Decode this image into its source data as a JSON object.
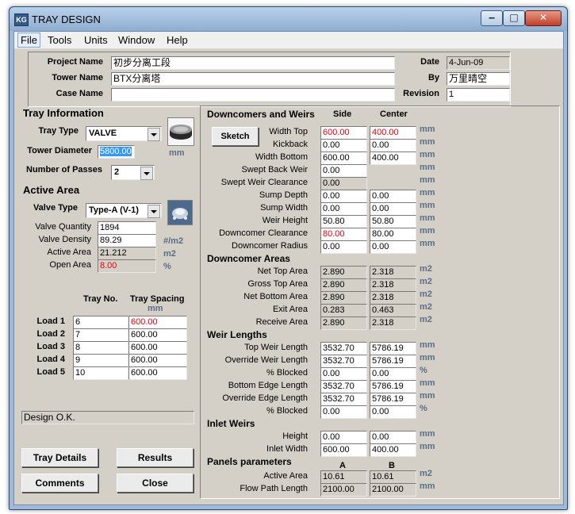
{
  "window": {
    "title": "TRAY DESIGN",
    "icon_text": "KG"
  },
  "menu": [
    "File",
    "Tools",
    "Units",
    "Window",
    "Help"
  ],
  "project": {
    "project_name_label": "Project Name",
    "project_name": "初步分离工段",
    "tower_name_label": "Tower Name",
    "tower_name": "BTX分离塔",
    "case_name_label": "Case Name",
    "case_name": "",
    "date_label": "Date",
    "date": "4-Jun-09",
    "by_label": "By",
    "by": "万里晴空",
    "revision_label": "Revision",
    "revision": "1"
  },
  "tray_info": {
    "title": "Tray Information",
    "tray_type_label": "Tray Type",
    "tray_type": "VALVE",
    "diameter_label": "Tower Diameter",
    "diameter": "5800.00",
    "diameter_unit": "mm",
    "passes_label": "Number of Passes",
    "passes": "2"
  },
  "active_area": {
    "title": "Active Area",
    "valve_type_label": "Valve Type",
    "valve_type": "Type-A (V-1)",
    "rows": [
      {
        "label": "Valve Quantity",
        "value": "1894",
        "unit": ""
      },
      {
        "label": "Valve Density",
        "value": "89.29",
        "unit": "#/m2"
      },
      {
        "label": "Active Area",
        "value": "21.212",
        "unit": "m2"
      },
      {
        "label": "Open Area",
        "value": "8.00",
        "unit": "%"
      }
    ]
  },
  "loads": {
    "col_tray_no": "Tray No.",
    "col_spacing": "Tray Spacing",
    "col_spacing_unit": "mm",
    "rows": [
      {
        "label": "Load 1",
        "tray": "6",
        "spacing": "600.00"
      },
      {
        "label": "Load 2",
        "tray": "7",
        "spacing": "600.00"
      },
      {
        "label": "Load 3",
        "tray": "8",
        "spacing": "600.00"
      },
      {
        "label": "Load 4",
        "tray": "9",
        "spacing": "600.00"
      },
      {
        "label": "Load 5",
        "tray": "10",
        "spacing": "600.00"
      }
    ]
  },
  "status": "Design O.K.",
  "buttons": {
    "tray_details": "Tray Details",
    "results": "Results",
    "comments": "Comments",
    "close": "Close",
    "sketch": "Sketch"
  },
  "downcomers": {
    "title": "Downcomers and Weirs",
    "col_side": "Side",
    "col_center": "Center",
    "rows": [
      {
        "label": "Width Top",
        "side": "600.00",
        "center": "400.00",
        "unit": "mm"
      },
      {
        "label": "Kickback",
        "side": "0.00",
        "center": "0.00",
        "unit": "mm"
      },
      {
        "label": "Width Bottom",
        "side": "600.00",
        "center": "400.00",
        "unit": "mm"
      },
      {
        "label": "Swept Back Weir",
        "side": "0.00",
        "center": "",
        "unit": "mm"
      },
      {
        "label": "Swept Weir Clearance",
        "side": "0.00",
        "center": "",
        "unit": "mm"
      },
      {
        "label": "Sump Depth",
        "side": "0.00",
        "center": "0.00",
        "unit": "mm"
      },
      {
        "label": "Sump Width",
        "side": "0.00",
        "center": "0.00",
        "unit": "mm"
      },
      {
        "label": "Weir Height",
        "side": "50.80",
        "center": "50.80",
        "unit": "mm"
      },
      {
        "label": "Downcomer Clearance",
        "side": "80.00",
        "center": "80.00",
        "unit": "mm"
      },
      {
        "label": "Downcomer Radius",
        "side": "0.00",
        "center": "0.00",
        "unit": "mm"
      }
    ]
  },
  "dc_areas": {
    "title": "Downcomer Areas",
    "rows": [
      {
        "label": "Net Top Area",
        "side": "2.890",
        "center": "2.318",
        "unit": "m2"
      },
      {
        "label": "Gross Top Area",
        "side": "2.890",
        "center": "2.318",
        "unit": "m2"
      },
      {
        "label": "Net Bottom Area",
        "side": "2.890",
        "center": "2.318",
        "unit": "m2"
      },
      {
        "label": "Exit Area",
        "side": "0.283",
        "center": "0.463",
        "unit": "m2"
      },
      {
        "label": "Receive Area",
        "side": "2.890",
        "center": "2.318",
        "unit": "m2"
      }
    ]
  },
  "weir_lengths": {
    "title": "Weir Lengths",
    "rows": [
      {
        "label": "Top Weir Length",
        "side": "3532.70",
        "center": "5786.19",
        "unit": "mm"
      },
      {
        "label": "Override Weir Length",
        "side": "3532.70",
        "center": "5786.19",
        "unit": "mm"
      },
      {
        "label": "% Blocked",
        "side": "0.00",
        "center": "0.00",
        "unit": "%"
      },
      {
        "label": "Bottom Edge Length",
        "side": "3532.70",
        "center": "5786.19",
        "unit": "mm"
      },
      {
        "label": "Override Edge Length",
        "side": "3532.70",
        "center": "5786.19",
        "unit": "mm"
      },
      {
        "label": "% Blocked",
        "side": "0.00",
        "center": "0.00",
        "unit": "%"
      }
    ]
  },
  "inlet_weirs": {
    "title": "Inlet Weirs",
    "rows": [
      {
        "label": "Height",
        "side": "0.00",
        "center": "0.00",
        "unit": "mm"
      },
      {
        "label": "Inlet Width",
        "side": "600.00",
        "center": "400.00",
        "unit": "mm"
      }
    ]
  },
  "panels": {
    "title": "Panels parameters",
    "col_a": "A",
    "col_b": "B",
    "rows": [
      {
        "label": "Active Area",
        "a": "10.61",
        "b": "10.61",
        "unit": "m2"
      },
      {
        "label": "Flow Path Length",
        "a": "2100.00",
        "b": "2100.00",
        "unit": "mm"
      }
    ]
  },
  "colors": {
    "error_red": "#e8000a",
    "unit_gray": "#5b6d85",
    "dialog_bg": "#d4d0c8",
    "frame_blue": "#9fb9d6"
  },
  "icons": [
    "tray-disc-icon",
    "valve-icon",
    "minimize-icon",
    "maximize-icon",
    "close-icon",
    "dropdown-arrow-icon"
  ]
}
